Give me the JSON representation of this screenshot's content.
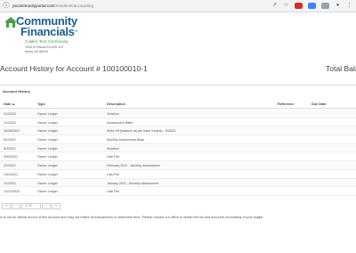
{
  "browser": {
    "url_host": "ptcommunityportal.com",
    "url_path": "/residents/accounting"
  },
  "brand": {
    "name_line1": "Community",
    "name_line2": "Financials",
    "trademark": "™",
    "association": "Calibre Test Community",
    "address_line1": "1044 N Piazza Ed Unit 110",
    "address_line2": "Mesa, AZ 85203",
    "colors": {
      "brand_blue": "#1d5f8c",
      "brand_green": "#4a9c4a"
    }
  },
  "page": {
    "title": "Account History for Account # 100100010-1",
    "total_label": "Total Balan"
  },
  "history": {
    "panel_title": "Account History",
    "columns": {
      "date": "Date ▲",
      "type": "Type",
      "description": "Description",
      "reference": "Reference",
      "due_date": "Due Date"
    },
    "rows": [
      {
        "date": "2/1/2022",
        "type": "Owner Ledger",
        "description": "Violation"
      },
      {
        "date": "2/1/2022",
        "type": "Owner Ledger",
        "description": "Assessment Billed"
      },
      {
        "date": "10/28/2021",
        "type": "Owner Ledger",
        "description": "Write Off (balance as per losse it basis) - 8/28/21"
      },
      {
        "date": "8/1/2021",
        "type": "Owner Ledger",
        "description": "Monthly Assessment Bank"
      },
      {
        "date": "5/3/2021",
        "type": "Owner Ledger",
        "description": "Violation"
      },
      {
        "date": "3/30/2021",
        "type": "Owner Ledger",
        "description": "Late Fee"
      },
      {
        "date": "2/1/2021",
        "type": "Owner Ledger",
        "description": "February 2021 - Monthly Assessment"
      },
      {
        "date": "1/31/2021",
        "type": "Owner Ledger",
        "description": "Late Fee"
      },
      {
        "date": "1/1/2021",
        "type": "Owner Ledger",
        "description": "January 2021 - Monthly Assessment"
      },
      {
        "date": "12/31/2020",
        "type": "Owner Ledger",
        "description": "Late Fee"
      }
    ]
  },
  "pager": {
    "first": "«",
    "prev": "‹",
    "page": "1 / 2",
    "next": "›",
    "last": "»"
  },
  "disclaimer": "is is not an official record of this account and may not reflect all transactions or statement fees. Please contact our office to obtain the full and accurate accounting of your ledger."
}
